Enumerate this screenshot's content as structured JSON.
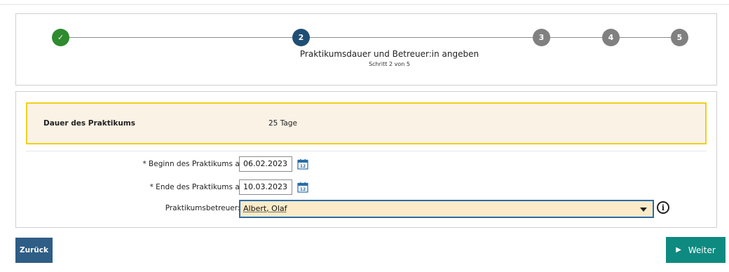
{
  "stepper": {
    "steps": [
      {
        "label": "✓",
        "state": "done"
      },
      {
        "label": "2",
        "state": "active"
      },
      {
        "label": "3",
        "state": "todo"
      },
      {
        "label": "4",
        "state": "todo"
      },
      {
        "label": "5",
        "state": "todo"
      }
    ],
    "title": "Praktikumsdauer und Betreuer:in angeben",
    "subtitle": "Schritt 2 von 5"
  },
  "duration": {
    "label": "Dauer des Praktikums",
    "value": "25 Tage"
  },
  "form": {
    "start_label": "* Beginn des Praktikums am",
    "start_value": "06.02.2023",
    "end_label": "* Ende des Praktikums am",
    "end_value": "10.03.2023",
    "supervisor_label": "Praktikumsbetreuer:in",
    "supervisor_value": "Albert, Olaf",
    "info_glyph": "i"
  },
  "buttons": {
    "back": "Zurück",
    "next": "Weiter",
    "next_glyph": "▶"
  },
  "colors": {
    "done": "#2e8b2e",
    "active": "#1f4e74",
    "todo": "#808080",
    "highlight_border": "#f1cf1b",
    "next_button": "#0f8a80",
    "back_button": "#2e5d86"
  },
  "icons": [
    "check-icon",
    "calendar-icon",
    "chevron-down-icon",
    "info-icon",
    "chevron-right-icon"
  ]
}
